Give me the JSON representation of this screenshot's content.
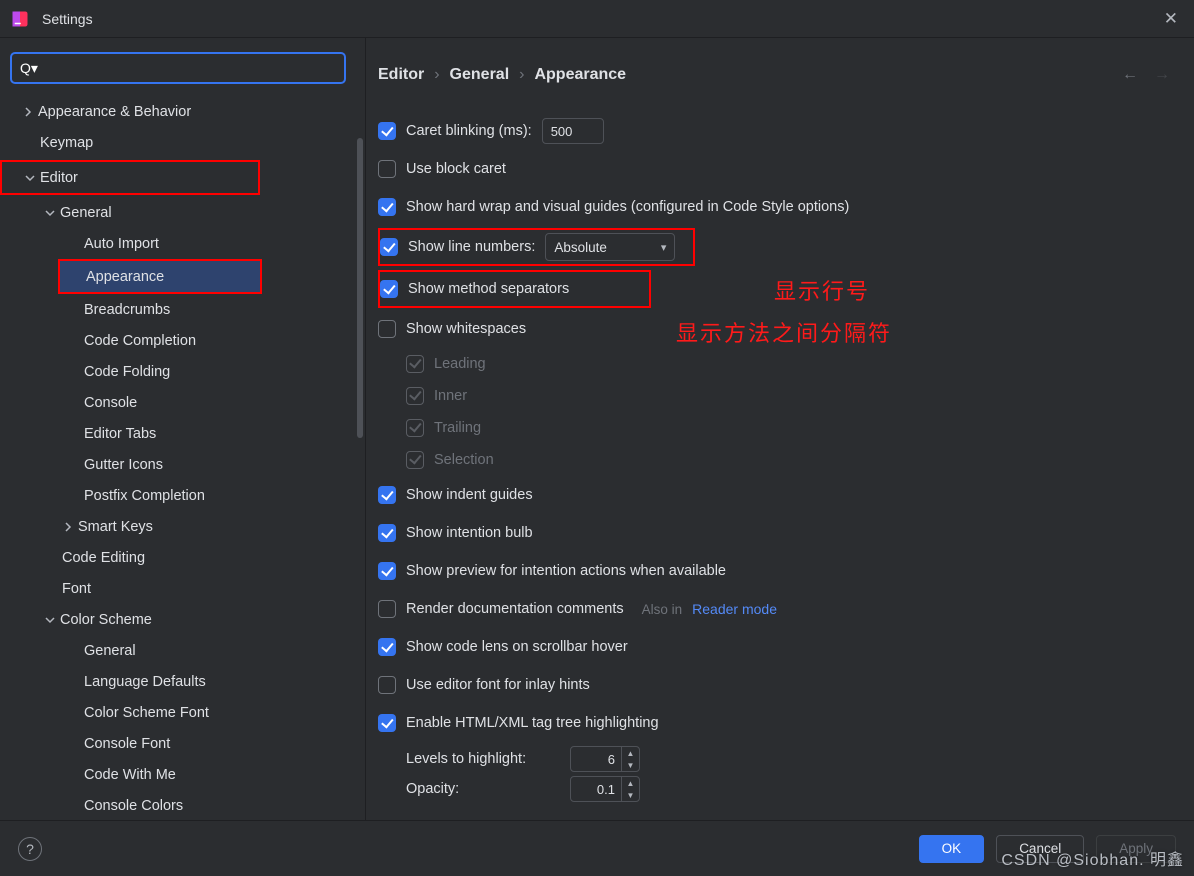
{
  "window": {
    "title": "Settings"
  },
  "search": {
    "prefix": "Q▾",
    "value": ""
  },
  "sidebar": {
    "items": [
      {
        "label": "Appearance & Behavior"
      },
      {
        "label": "Keymap"
      },
      {
        "label": "Editor"
      },
      {
        "label": "General"
      },
      {
        "label": "Auto Import"
      },
      {
        "label": "Appearance"
      },
      {
        "label": "Breadcrumbs"
      },
      {
        "label": "Code Completion"
      },
      {
        "label": "Code Folding"
      },
      {
        "label": "Console"
      },
      {
        "label": "Editor Tabs"
      },
      {
        "label": "Gutter Icons"
      },
      {
        "label": "Postfix Completion"
      },
      {
        "label": "Smart Keys"
      },
      {
        "label": "Code Editing"
      },
      {
        "label": "Font"
      },
      {
        "label": "Color Scheme"
      },
      {
        "label": "General"
      },
      {
        "label": "Language Defaults"
      },
      {
        "label": "Color Scheme Font"
      },
      {
        "label": "Console Font"
      },
      {
        "label": "Code With Me"
      },
      {
        "label": "Console Colors"
      }
    ]
  },
  "breadcrumb": {
    "a": "Editor",
    "b": "General",
    "c": "Appearance"
  },
  "options": {
    "caret_blinking_label": "Caret blinking (ms):",
    "caret_blinking_value": "500",
    "use_block_caret": "Use block caret",
    "show_hard_wrap": "Show hard wrap and visual guides (configured in Code Style options)",
    "show_line_numbers": "Show line numbers:",
    "line_numbers_mode": "Absolute",
    "show_method_separators": "Show method separators",
    "show_whitespaces": "Show whitespaces",
    "ws_leading": "Leading",
    "ws_inner": "Inner",
    "ws_trailing": "Trailing",
    "ws_selection": "Selection",
    "show_indent_guides": "Show indent guides",
    "show_intention_bulb": "Show intention bulb",
    "show_preview_intention": "Show preview for intention actions when available",
    "render_doc_comments": "Render documentation comments",
    "also_in": "Also in",
    "reader_mode": "Reader mode",
    "show_code_lens": "Show code lens on scrollbar hover",
    "use_editor_font_inlay": "Use editor font for inlay hints",
    "enable_html_tag_tree": "Enable HTML/XML tag tree highlighting",
    "levels_to_highlight": "Levels to highlight:",
    "levels_value": "6",
    "opacity_label": "Opacity:",
    "opacity_value": "0.1"
  },
  "annotations": {
    "line1": "显示行号",
    "line2": "显示方法之间分隔符"
  },
  "footer": {
    "ok": "OK",
    "cancel": "Cancel",
    "apply": "Apply"
  },
  "watermark": "CSDN @Siobhan. 明鑫"
}
